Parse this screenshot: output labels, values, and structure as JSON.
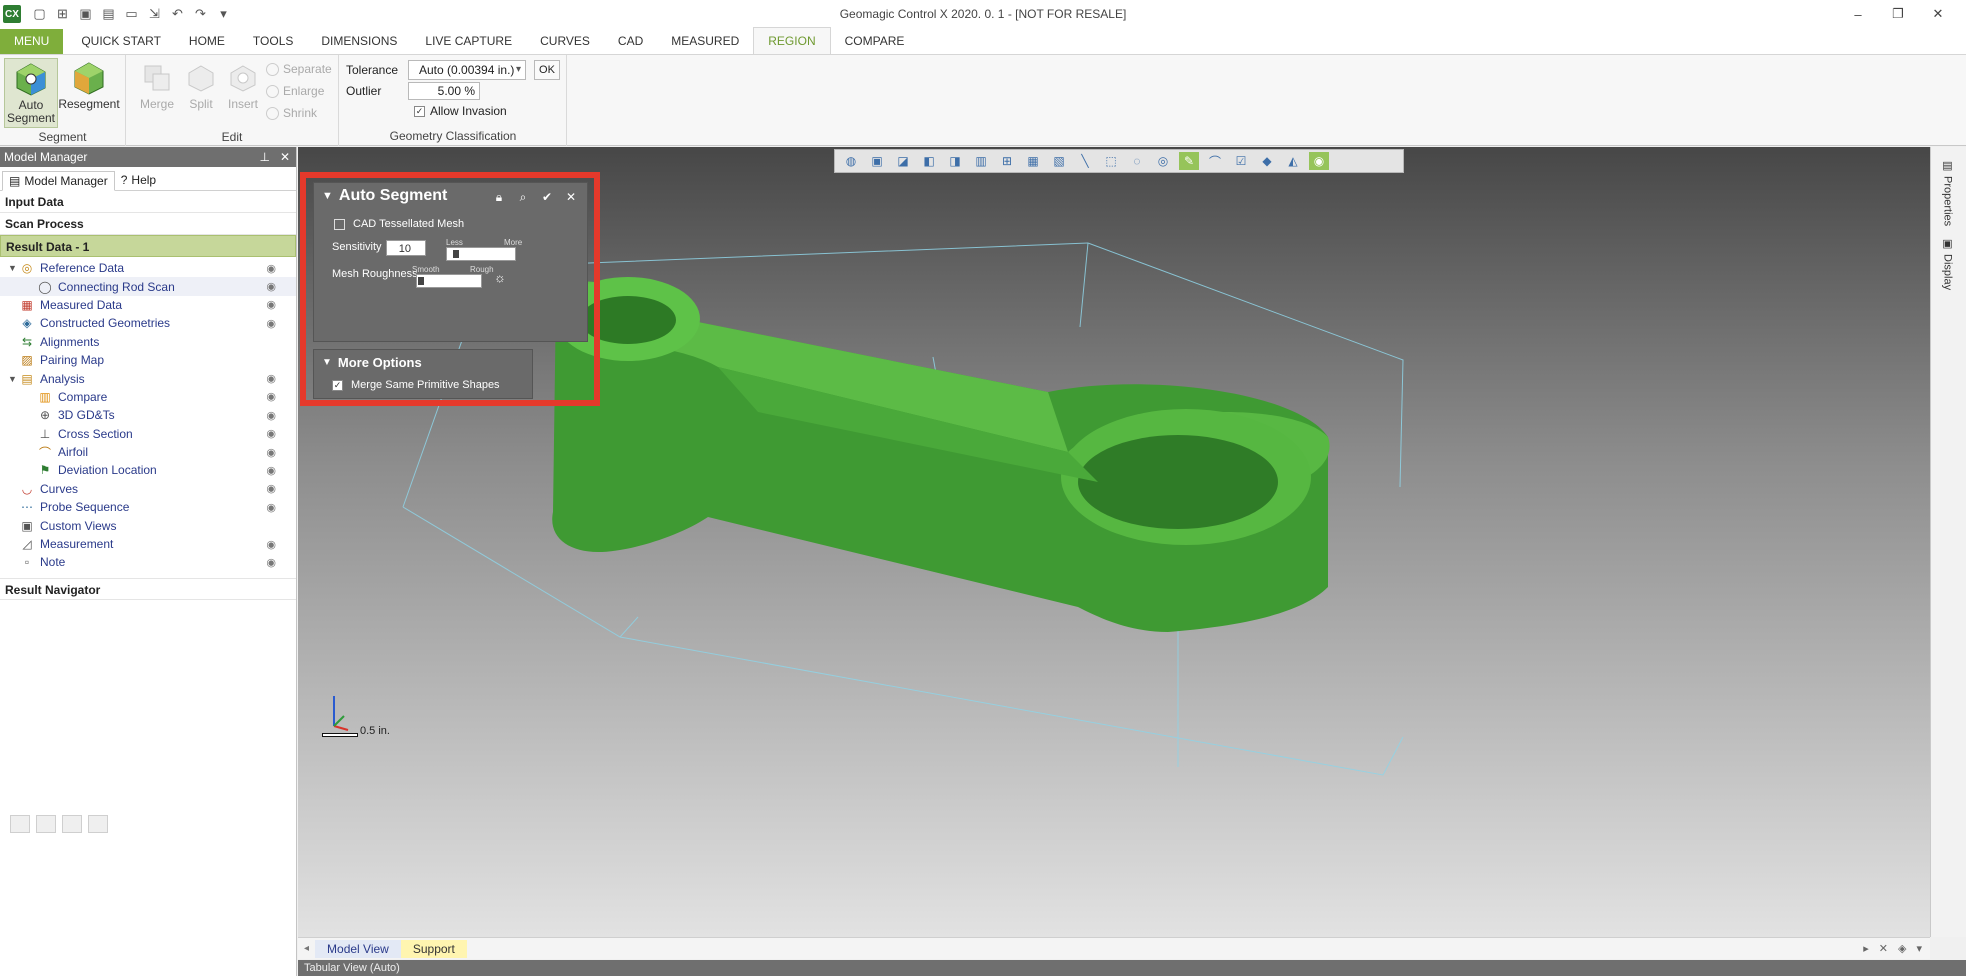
{
  "window": {
    "title": "Geomagic Control X 2020. 0. 1 - [NOT FOR RESALE]",
    "app_badge": "CX"
  },
  "ribbon_tabs": [
    "MENU",
    "QUICK START",
    "HOME",
    "TOOLS",
    "DIMENSIONS",
    "LIVE CAPTURE",
    "CURVES",
    "CAD",
    "MEASURED",
    "REGION",
    "COMPARE"
  ],
  "ribbon": {
    "segment_group": {
      "label": "Segment",
      "auto_segment": "Auto Segment",
      "resegment": "Resegment"
    },
    "edit_group": {
      "label": "Edit",
      "merge": "Merge",
      "split": "Split",
      "insert": "Insert",
      "separate": "Separate",
      "enlarge": "Enlarge",
      "shrink": "Shrink"
    },
    "geometry_group": {
      "label": "Geometry Classification",
      "tolerance_label": "Tolerance",
      "tolerance_value": "Auto (0.00394 in.)",
      "ok": "OK",
      "outlier_label": "Outlier",
      "outlier_value": "5.00 %",
      "allow_invasion": "Allow Invasion"
    }
  },
  "model_manager": {
    "title": "Model Manager",
    "tabs": [
      "Model Manager",
      "Help"
    ],
    "input_data": "Input Data",
    "scan_process": "Scan Process",
    "result_data": "Result Data - 1",
    "tree": [
      {
        "label": "Reference Data",
        "indent": 0,
        "twisty": true,
        "eye": true
      },
      {
        "label": "Connecting Rod Scan",
        "indent": 1,
        "twisty": false,
        "eye": true
      },
      {
        "label": "Measured Data",
        "indent": 0,
        "twisty": false,
        "eye": true
      },
      {
        "label": "Constructed Geometries",
        "indent": 0,
        "twisty": false,
        "eye": true
      },
      {
        "label": "Alignments",
        "indent": 0,
        "twisty": false,
        "eye": false
      },
      {
        "label": "Pairing Map",
        "indent": 0,
        "twisty": false,
        "eye": false
      },
      {
        "label": "Analysis",
        "indent": 0,
        "twisty": true,
        "eye": true
      },
      {
        "label": "Compare",
        "indent": 1,
        "twisty": false,
        "eye": true
      },
      {
        "label": "3D GD&Ts",
        "indent": 1,
        "twisty": false,
        "eye": true
      },
      {
        "label": "Cross Section",
        "indent": 1,
        "twisty": false,
        "eye": true
      },
      {
        "label": "Airfoil",
        "indent": 1,
        "twisty": false,
        "eye": true
      },
      {
        "label": "Deviation Location",
        "indent": 1,
        "twisty": false,
        "eye": true
      },
      {
        "label": "Curves",
        "indent": 0,
        "twisty": false,
        "eye": true
      },
      {
        "label": "Probe Sequence",
        "indent": 0,
        "twisty": false,
        "eye": true
      },
      {
        "label": "Custom Views",
        "indent": 0,
        "twisty": false,
        "eye": false
      },
      {
        "label": "Measurement",
        "indent": 0,
        "twisty": false,
        "eye": true
      },
      {
        "label": "Note",
        "indent": 0,
        "twisty": false,
        "eye": true
      }
    ],
    "result_navigator": "Result Navigator"
  },
  "auto_segment": {
    "title": "Auto Segment",
    "cad_tessellated": "CAD Tessellated Mesh",
    "sensitivity_label": "Sensitivity",
    "sensitivity_value": "10",
    "sensitivity_less": "Less",
    "sensitivity_more": "More",
    "sensitivity_level": 0.1,
    "roughness_label": "Mesh Roughness",
    "roughness_smooth": "Smooth",
    "roughness_rough": "Rough",
    "roughness_level": 0.02,
    "more_options": "More Options",
    "merge_same": "Merge Same Primitive Shapes"
  },
  "viewport": {
    "scale": "0.5 in.",
    "part_color": "#4caf3a"
  },
  "right_dock": [
    "Properties",
    "Display"
  ],
  "view_tabs": [
    "Model View",
    "Support"
  ],
  "tabular_view": "Tabular View (Auto)"
}
